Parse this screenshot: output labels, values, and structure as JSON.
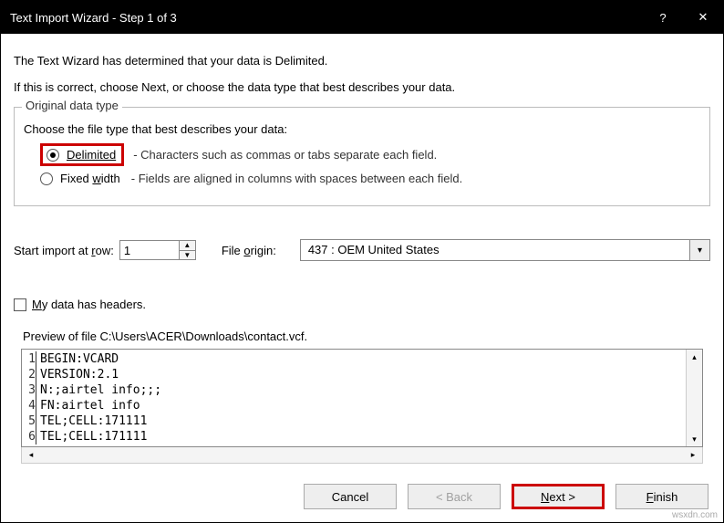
{
  "window": {
    "title": "Text Import Wizard - Step 1 of 3",
    "help": "?",
    "close": "✕"
  },
  "intro": {
    "line1": "The Text Wizard has determined that your data is Delimited.",
    "line2": "If this is correct, choose Next, or choose the data type that best describes your data."
  },
  "group": {
    "legend": "Original data type",
    "prompt": "Choose the file type that best describes your data:",
    "delimited": {
      "name": "Delimited",
      "desc": "- Characters such as commas or tabs separate each field.",
      "selected": true
    },
    "fixed": {
      "name_pre": "Fixed ",
      "name_ul": "w",
      "name_post": "idth",
      "desc": "- Fields are aligned in columns with spaces between each field.",
      "selected": false
    }
  },
  "start_row": {
    "label_pre": "Start import at ",
    "label_ul": "r",
    "label_post": "ow:",
    "value": "1"
  },
  "origin": {
    "label_pre": "File ",
    "label_ul": "o",
    "label_post": "rigin:",
    "value": "437 : OEM United States"
  },
  "headers": {
    "label_ul": "M",
    "label_post": "y data has headers.",
    "checked": false
  },
  "preview": {
    "label": "Preview of file C:\\Users\\ACER\\Downloads\\contact.vcf.",
    "lines": [
      "BEGIN:VCARD",
      "VERSION:2.1",
      "N:;airtel info;;;",
      "FN:airtel info",
      "TEL;CELL:171111",
      "TEL;CELL:171111"
    ]
  },
  "buttons": {
    "cancel": "Cancel",
    "back": "< Back",
    "next_ul": "N",
    "next_post": "ext >",
    "finish_ul": "F",
    "finish_post": "inish"
  },
  "watermark": "wsxdn.com"
}
